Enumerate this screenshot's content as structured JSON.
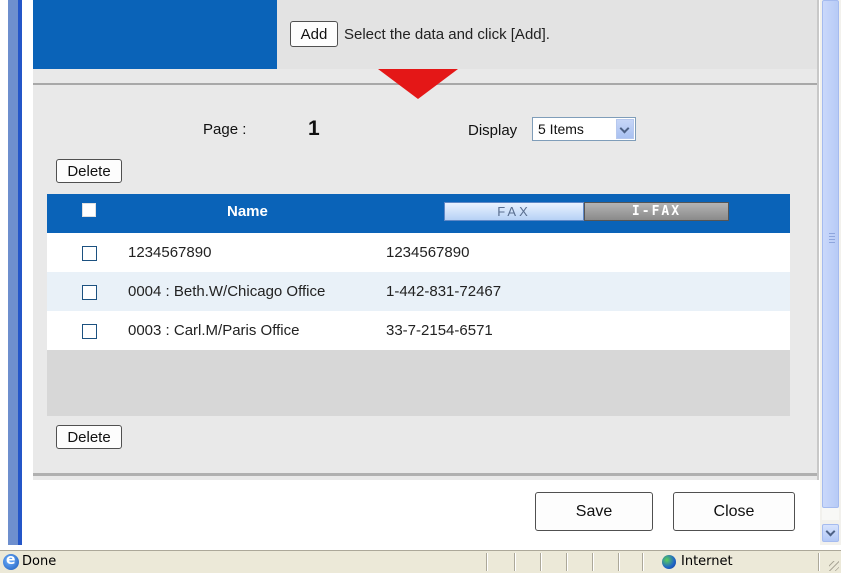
{
  "top": {
    "add_label": "Add",
    "add_hint": "Select the data and click [Add]."
  },
  "pager": {
    "page_label": "Page :",
    "page_number": "1",
    "display_label": "Display",
    "display_value": "5 Items"
  },
  "actions": {
    "delete_label": "Delete",
    "save_label": "Save",
    "close_label": "Close"
  },
  "table": {
    "header_name": "Name",
    "tabs": [
      {
        "label": "FAX",
        "selected": true
      },
      {
        "label": "I-FAX",
        "selected": false
      }
    ],
    "rows": [
      {
        "name": "1234567890",
        "number": "1234567890"
      },
      {
        "name": "0004 : Beth.W/Chicago Office",
        "number": "1-442-831-72467"
      },
      {
        "name": "0003 : Carl.M/Paris Office",
        "number": "33-7-2154-6571"
      }
    ]
  },
  "statusbar": {
    "status": "Done",
    "zone": "Internet"
  },
  "colors": {
    "accent_blue": "#0a63b8",
    "arrow_red": "#e41717",
    "row_alt": "#e9f1f8"
  },
  "icons": {
    "status": "ie-page-icon",
    "zone": "internet-globe-icon"
  }
}
